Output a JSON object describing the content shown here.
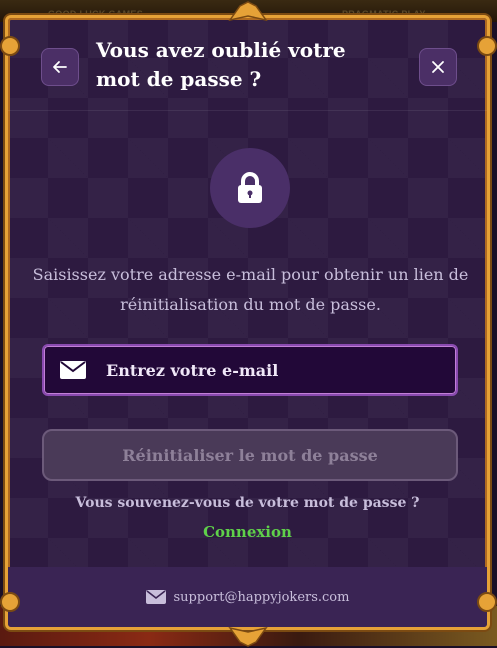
{
  "background": {
    "left_title": "GOOD LUCK GAMES",
    "right_title": "PRAGMATIC PLAY"
  },
  "header": {
    "title": "Vous avez oublié votre mot de passe ?",
    "back_icon": "arrow-left-icon",
    "close_icon": "close-icon"
  },
  "lock_icon": "lock-icon",
  "description": "Saisissez votre adresse e-mail pour obtenir un lien de réinitialisation du mot de passe.",
  "email": {
    "placeholder": "Entrez votre e-mail",
    "value": "",
    "icon": "envelope-icon"
  },
  "reset_button": {
    "label": "Réinitialiser le mot de passe",
    "enabled": false
  },
  "remember_text": "Vous souvenez-vous de votre mot de passe ?",
  "login_link": "Connexion",
  "footer": {
    "email": "support@happyjokers.com",
    "icon": "envelope-icon"
  },
  "colors": {
    "modal_bg": "#2d1a40",
    "border_gold": "#e6a237",
    "link_green": "#5fd14a",
    "field_bg": "#220838"
  }
}
